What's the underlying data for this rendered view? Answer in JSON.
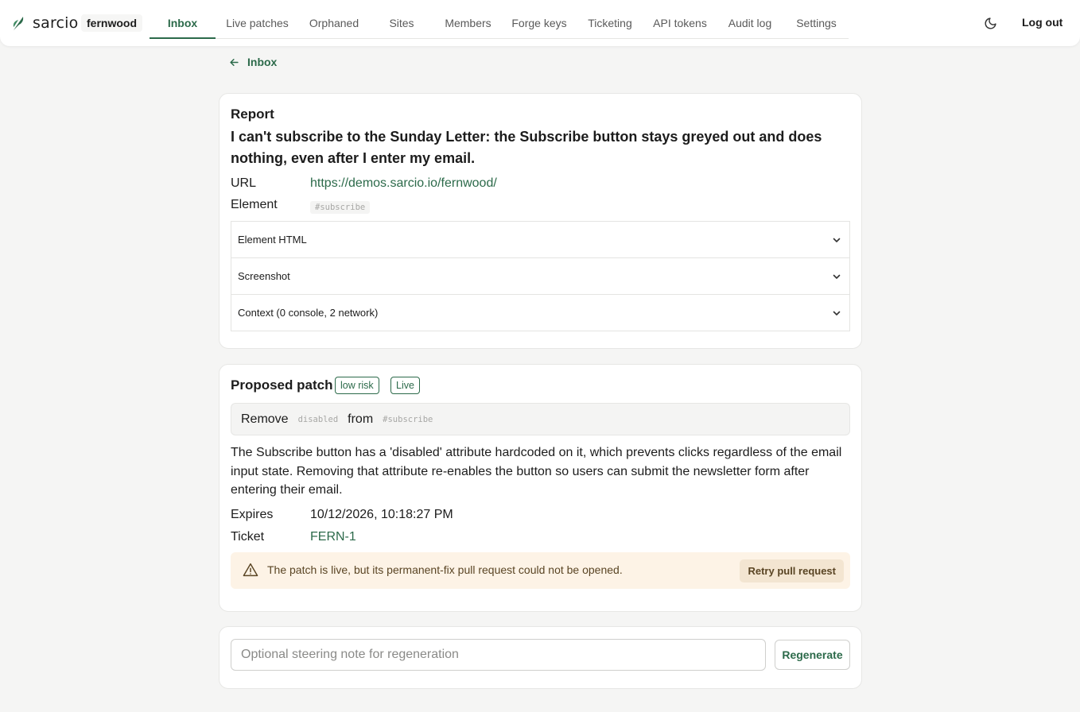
{
  "brand": {
    "name": "sarcio",
    "logo_icon": "leaf-logo-icon"
  },
  "org": "fernwood",
  "nav": {
    "tabs": [
      {
        "label": "Inbox",
        "active": true
      },
      {
        "label": "Live patches",
        "active": false
      },
      {
        "label": "Orphaned",
        "active": false
      },
      {
        "label": "Sites",
        "active": false
      },
      {
        "label": "Members",
        "active": false
      },
      {
        "label": "Forge keys",
        "active": false
      },
      {
        "label": "Ticketing",
        "active": false
      },
      {
        "label": "API tokens",
        "active": false
      },
      {
        "label": "Audit log",
        "active": false
      },
      {
        "label": "Settings",
        "active": false
      }
    ],
    "theme_icon": "moon-icon",
    "logout": "Log out"
  },
  "back": {
    "label": "Inbox",
    "icon": "arrow-left-icon"
  },
  "report": {
    "heading": "Report",
    "title": "I can't subscribe to the Sunday Letter: the Subscribe button stays greyed out and does nothing, even after I enter my email.",
    "url_label": "URL",
    "url": "https://demos.sarcio.io/fernwood/",
    "element_label": "Element",
    "element": "#subscribe",
    "sections": [
      {
        "label": "Element HTML"
      },
      {
        "label": "Screenshot"
      },
      {
        "label": "Context (0 console, 2 network)"
      }
    ]
  },
  "patch": {
    "heading": "Proposed patch",
    "badges": [
      "low risk",
      "Live"
    ],
    "summary": {
      "verb": "Remove",
      "attr": "disabled",
      "prep": "from",
      "target": "#subscribe"
    },
    "description": "The Subscribe button has a 'disabled' attribute hardcoded on it, which prevents clicks regardless of the email input state. Removing that attribute re-enables the button so users can submit the newsletter form after entering their email.",
    "expires_label": "Expires",
    "expires": "10/12/2026, 10:18:27 PM",
    "ticket_label": "Ticket",
    "ticket": "FERN-1",
    "alert": {
      "icon": "warning-triangle-icon",
      "text": "The patch is live, but its permanent-fix pull request could not be opened.",
      "button": "Retry pull request"
    }
  },
  "regenerate": {
    "placeholder": "Optional steering note for regeneration",
    "value": "",
    "button": "Regenerate"
  },
  "colors": {
    "accent": "#2c6a4a",
    "background": "#f5f5f4",
    "alert_bg": "#fdf3e6"
  }
}
